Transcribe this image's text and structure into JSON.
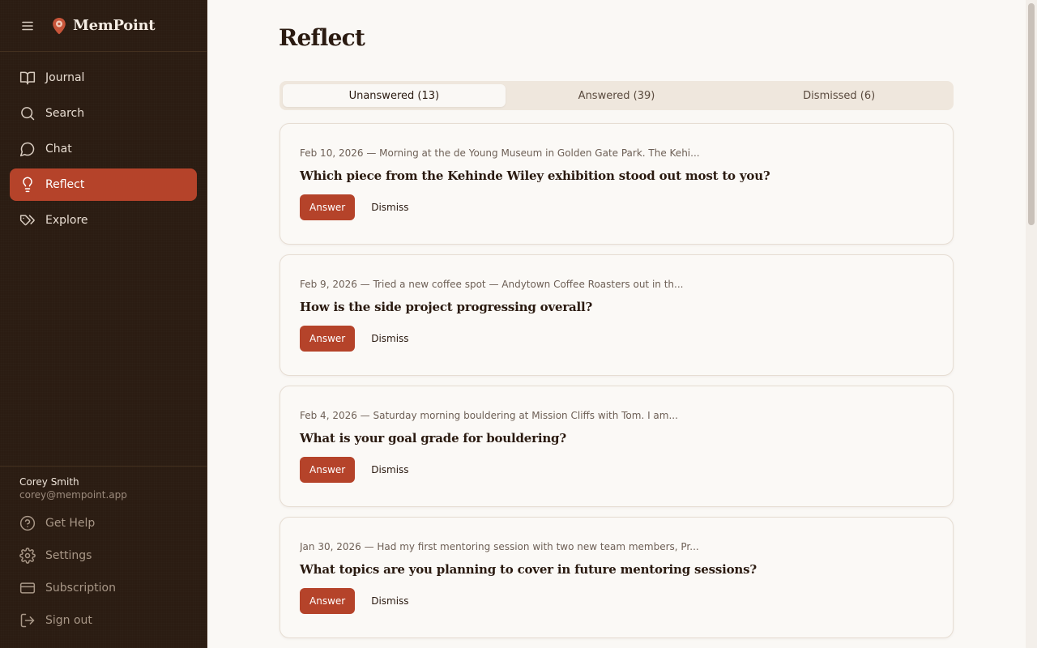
{
  "app": {
    "name": "MemPoint"
  },
  "sidebar": {
    "items": [
      {
        "label": "Journal",
        "icon": "book-icon"
      },
      {
        "label": "Search",
        "icon": "search-icon"
      },
      {
        "label": "Chat",
        "icon": "chat-bubble-icon"
      },
      {
        "label": "Reflect",
        "icon": "lightbulb-icon",
        "active": true
      },
      {
        "label": "Explore",
        "icon": "tags-icon"
      }
    ],
    "user": {
      "name": "Corey Smith",
      "email": "corey@mempoint.app"
    },
    "footer": [
      {
        "label": "Get Help",
        "icon": "help-circle-icon"
      },
      {
        "label": "Settings",
        "icon": "gear-icon"
      },
      {
        "label": "Subscription",
        "icon": "credit-card-icon"
      },
      {
        "label": "Sign out",
        "icon": "sign-out-icon"
      }
    ]
  },
  "main": {
    "title": "Reflect",
    "tabs": [
      {
        "label": "Unanswered (13)",
        "active": true
      },
      {
        "label": "Answered (39)"
      },
      {
        "label": "Dismissed (6)"
      }
    ],
    "cards": [
      {
        "meta": "Feb 10, 2026 — Morning at the de Young Museum in Golden Gate Park. The Kehi...",
        "question": "Which piece from the Kehinde Wiley exhibition stood out most to you?",
        "answer_label": "Answer",
        "dismiss_label": "Dismiss"
      },
      {
        "meta": "Feb 9, 2026 — Tried a new coffee spot — Andytown Coffee Roasters out in th...",
        "question": "How is the side project progressing overall?",
        "answer_label": "Answer",
        "dismiss_label": "Dismiss"
      },
      {
        "meta": "Feb 4, 2026 — Saturday morning bouldering at Mission Cliffs with Tom. I am...",
        "question": "What is your goal grade for bouldering?",
        "answer_label": "Answer",
        "dismiss_label": "Dismiss"
      },
      {
        "meta": "Jan 30, 2026 — Had my first mentoring session with two new team members, Pr...",
        "question": "What topics are you planning to cover in future mentoring sessions?",
        "answer_label": "Answer",
        "dismiss_label": "Dismiss"
      }
    ]
  },
  "colors": {
    "sidebar_bg": "#2b1c12",
    "accent": "#b5432a",
    "page_bg": "#faf8f5",
    "card_border": "#e6ddd3"
  }
}
